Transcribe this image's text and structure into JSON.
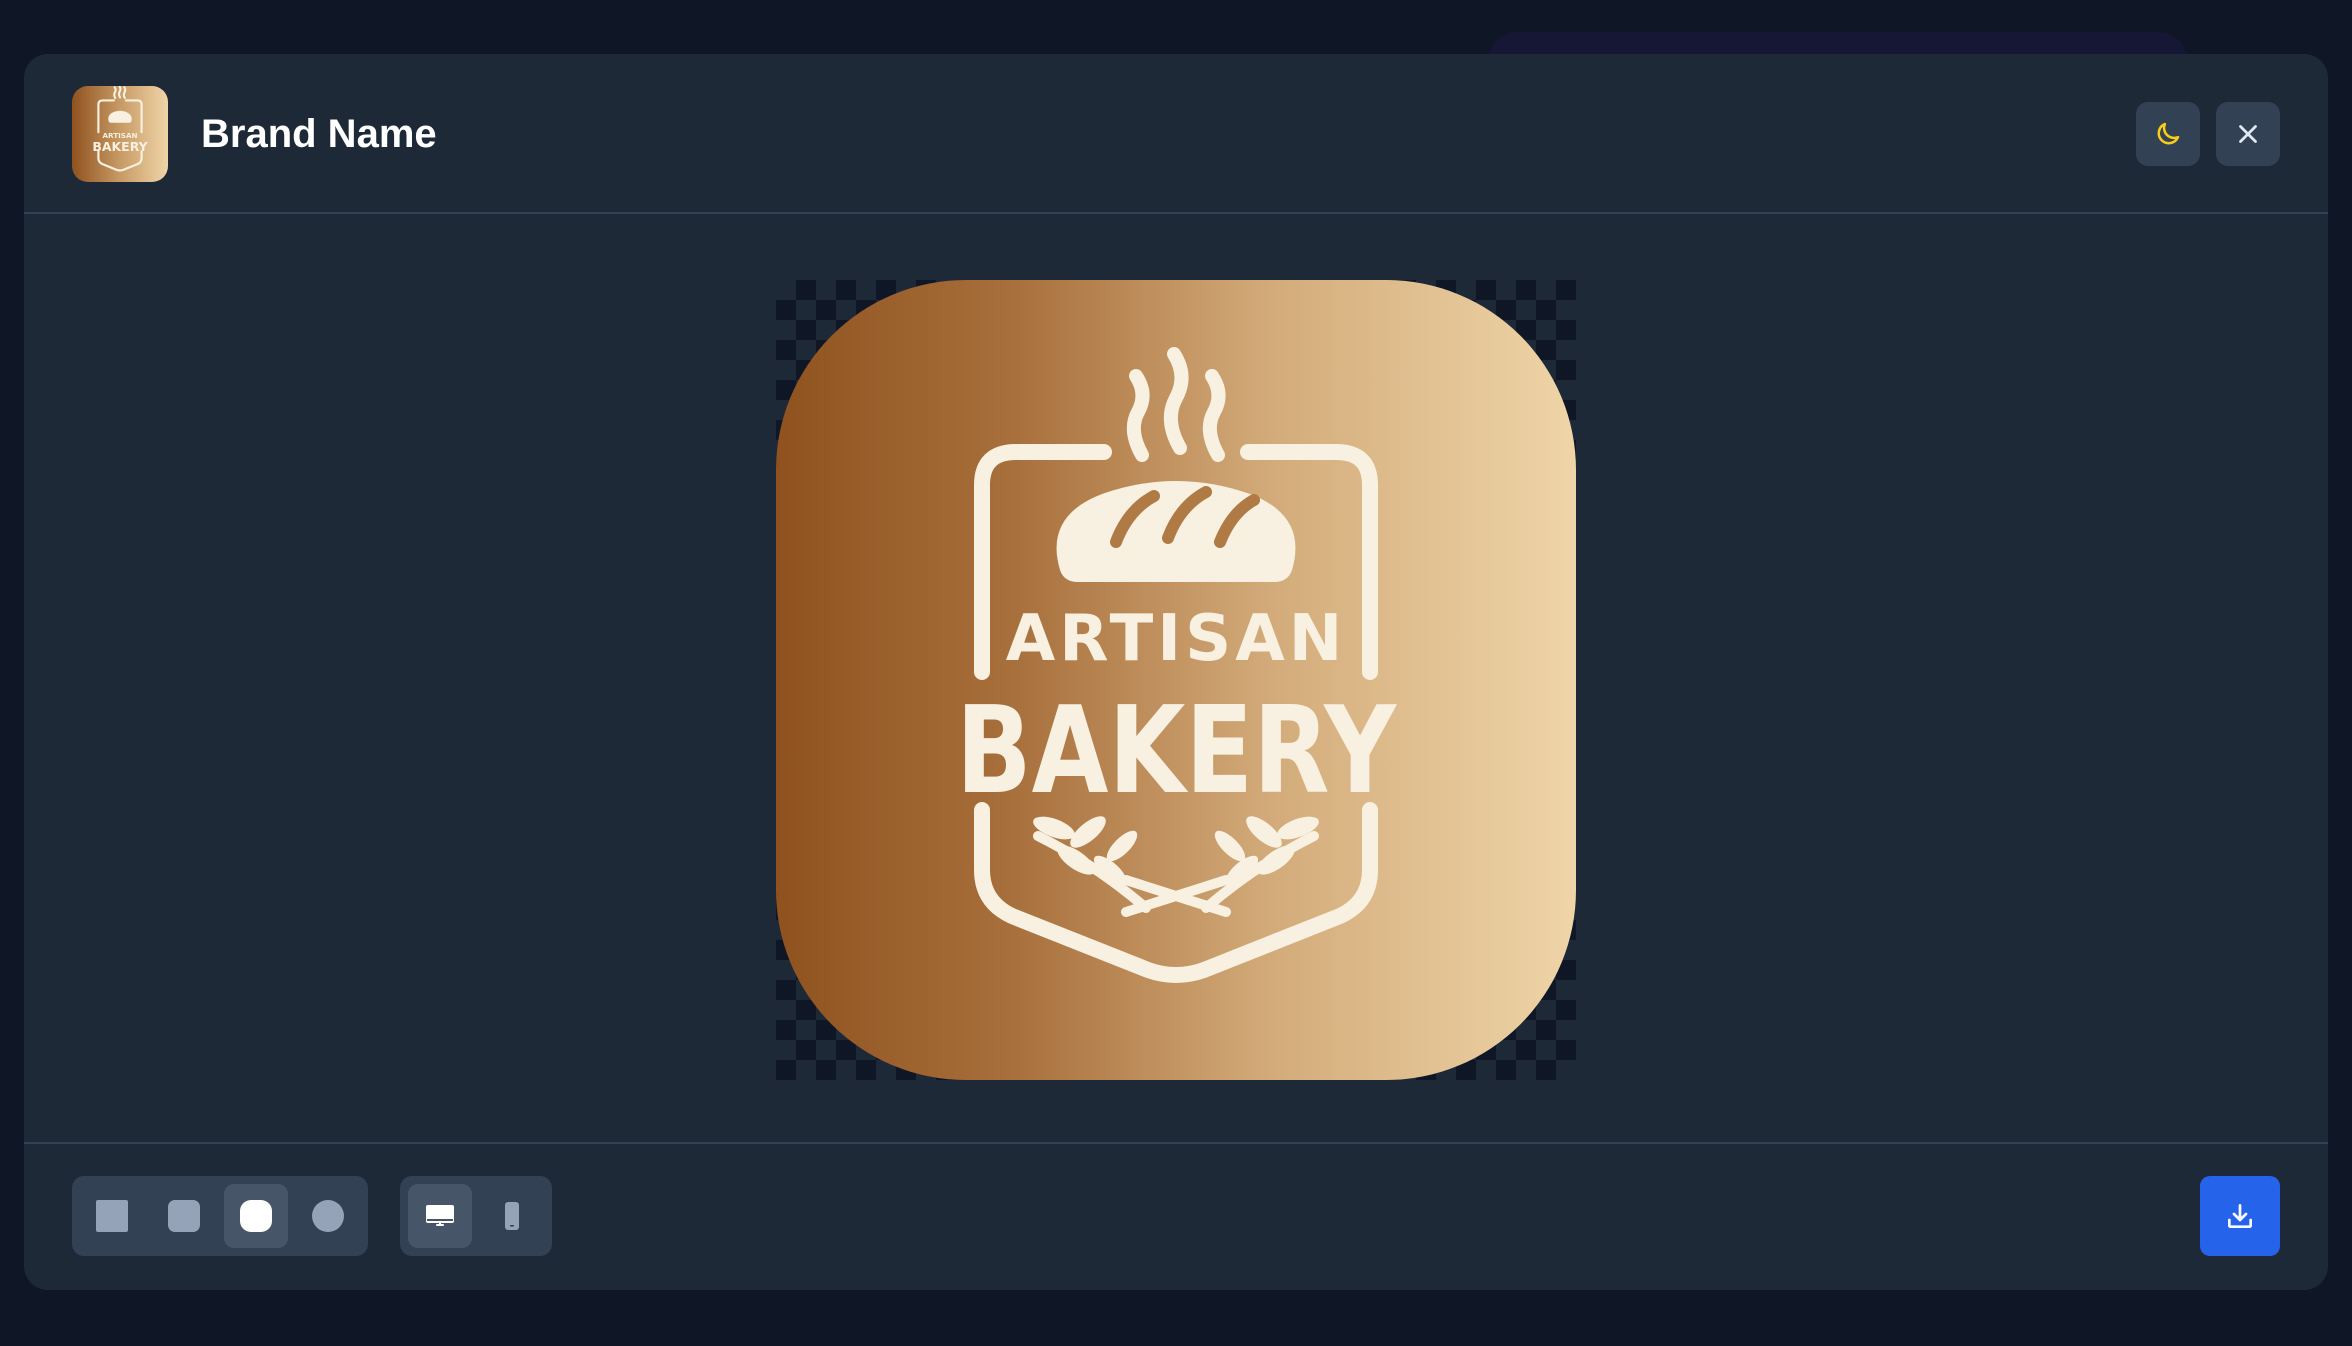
{
  "header": {
    "title": "Brand Name",
    "theme_icon": "moon-icon",
    "close_icon": "close-icon"
  },
  "logo": {
    "line1": "ARTISAN",
    "line2": "BAKERY",
    "gradient_start": "#8f521f",
    "gradient_end": "#efd5a8",
    "ink": "#f8f0e0"
  },
  "shape_options": [
    {
      "name": "square",
      "active": false
    },
    {
      "name": "rounded",
      "active": false
    },
    {
      "name": "squircle",
      "active": true
    },
    {
      "name": "circle",
      "active": false
    }
  ],
  "device_options": [
    {
      "name": "desktop",
      "active": true
    },
    {
      "name": "mobile",
      "active": false
    }
  ],
  "colors": {
    "accent": "#2563eb",
    "moon": "#facc15",
    "panel": "#1e2938",
    "background": "#0f1726"
  }
}
